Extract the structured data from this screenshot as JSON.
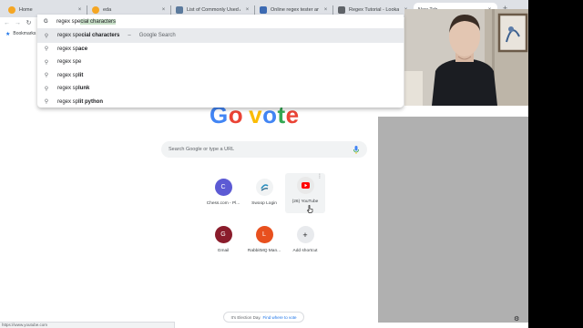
{
  "tabs": [
    {
      "title": "Home",
      "active": false,
      "favicon_color": "#f5a623"
    },
    {
      "title": "eda",
      "active": false,
      "favicon_color": "#f5a623"
    },
    {
      "title": "List of Commonly Used Al...",
      "active": false,
      "favicon_color": "#5b7a9d"
    },
    {
      "title": "Online regex tester and de...",
      "active": false,
      "favicon_color": "#3d6bb3"
    },
    {
      "title": "Regex Tutorial - Lookaheac",
      "active": false,
      "favicon_color": "#5f6368"
    },
    {
      "title": "New Tab",
      "active": true,
      "favicon_color": ""
    }
  ],
  "bookmarks_bar": {
    "label": "Bookmarks"
  },
  "omnibox": {
    "typed": "regex spe",
    "completion": "cial characters"
  },
  "suggestions": [
    {
      "prefix": "regex spe",
      "bold": "cial characters",
      "suffix": "Google Search",
      "highlighted": true
    },
    {
      "prefix": "regex sp",
      "bold": "ace",
      "suffix": "",
      "highlighted": false
    },
    {
      "prefix": "regex spe",
      "bold": "",
      "suffix": "",
      "highlighted": false
    },
    {
      "prefix": "regex sp",
      "bold": "lit",
      "suffix": "",
      "highlighted": false
    },
    {
      "prefix": "regex sp",
      "bold": "lunk",
      "suffix": "",
      "highlighted": false
    },
    {
      "prefix": "regex sp",
      "bold": "lit python",
      "suffix": "",
      "highlighted": false
    }
  ],
  "doodle": {
    "letters": [
      "G",
      "o",
      " ",
      "v",
      "o",
      "t",
      "e"
    ]
  },
  "search": {
    "placeholder": "Search Google or type a URL"
  },
  "shortcuts": [
    {
      "letter": "C",
      "name": "Chess.com - Pl...",
      "color": "#5c5ad4"
    },
    {
      "letter": "",
      "name": "Swoop Login",
      "color": "#f1f3f4"
    },
    {
      "letter": "",
      "name": "(26) YouTube",
      "color": "#e9e9e9"
    },
    {
      "letter": "G",
      "name": "Gmail",
      "color": "#8a1c2b"
    },
    {
      "letter": "L",
      "name": "RabbitMQ Man...",
      "color": "#e8501e"
    },
    {
      "letter": "+",
      "name": "Add shortcut",
      "color": "#e8eaed"
    }
  ],
  "election": {
    "text": "It's Election Day.",
    "link": "Find where to vote"
  },
  "status_url": "https://www.youtube.com"
}
